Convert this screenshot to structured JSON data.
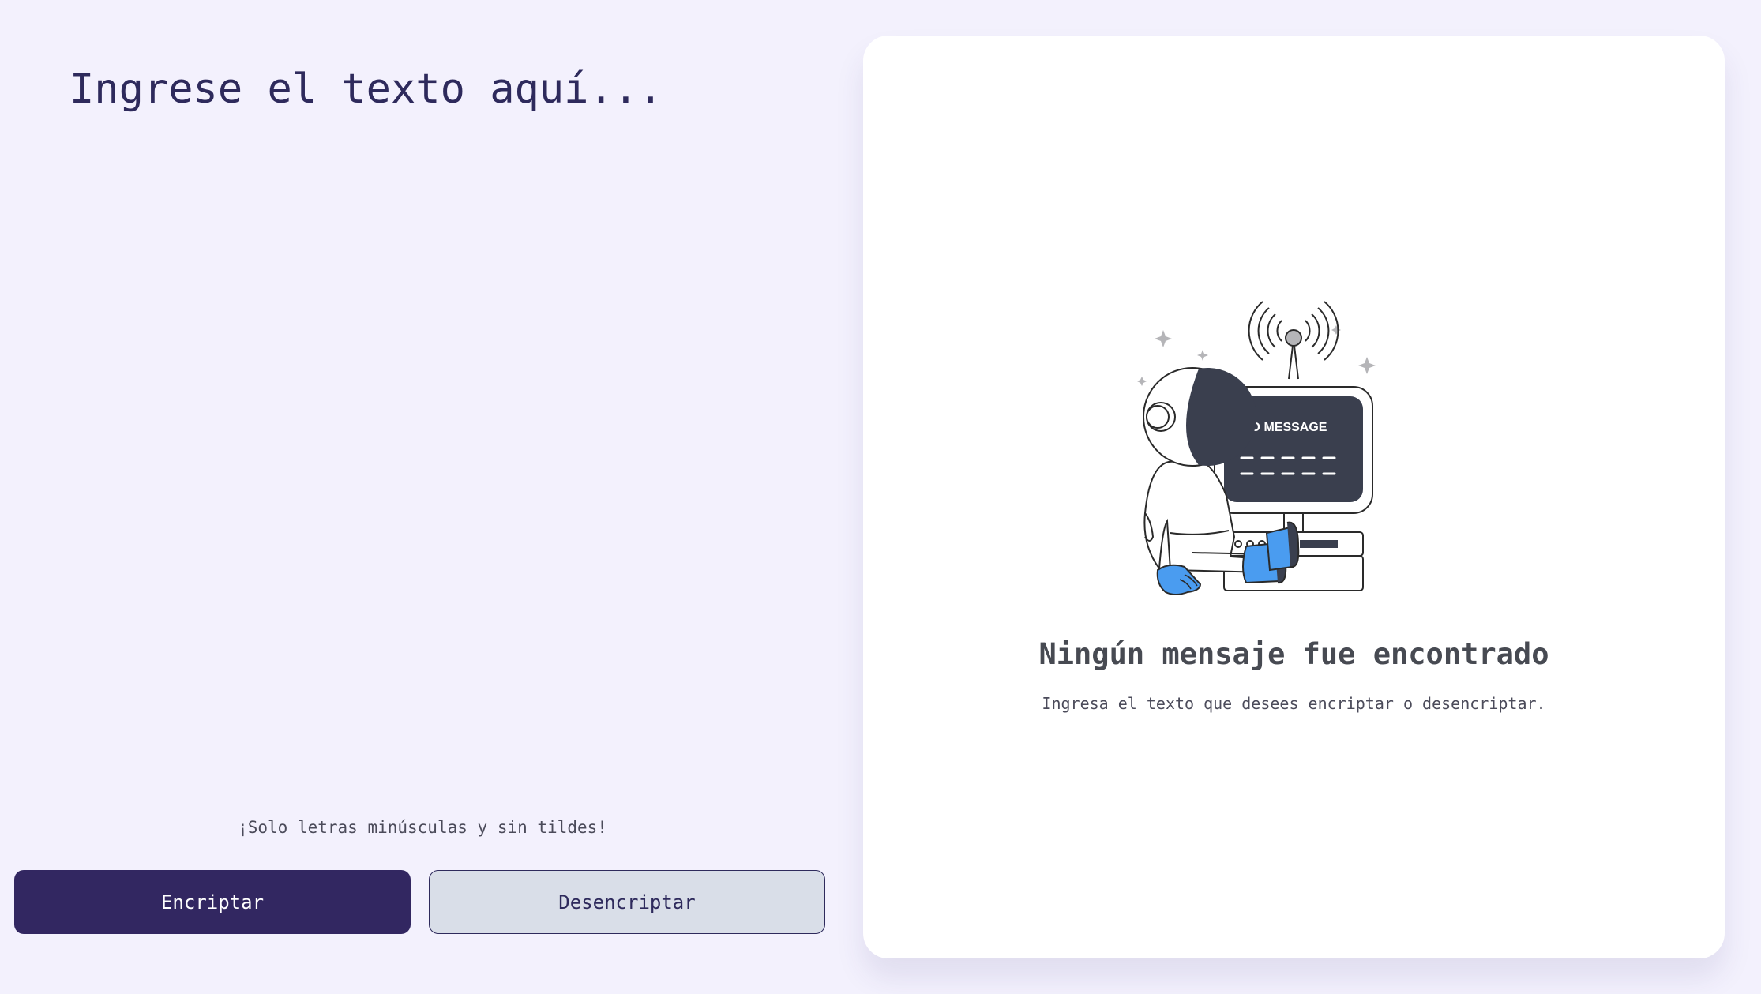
{
  "input": {
    "placeholder": "Ingrese el texto aquí...",
    "value": ""
  },
  "hint": {
    "icon": "info-icon",
    "text": "¡Solo letras minúsculas y sin tildes!"
  },
  "buttons": {
    "encrypt_label": "Encriptar",
    "decrypt_label": "Desencriptar"
  },
  "output": {
    "illustration": {
      "icon": "astronaut-no-message-illustration",
      "screen_text": "NO MESSAGE"
    },
    "title": "Ningún mensaje fue encontrado",
    "subtitle": "Ingresa el texto que desees encriptar o desencriptar."
  },
  "colors": {
    "background": "#f3f1fd",
    "primary": "#322761",
    "secondary": "#d9dee8",
    "card": "#ffffff",
    "accent_blue": "#4a9cf0",
    "illustration_dark": "#3a3f4e"
  }
}
